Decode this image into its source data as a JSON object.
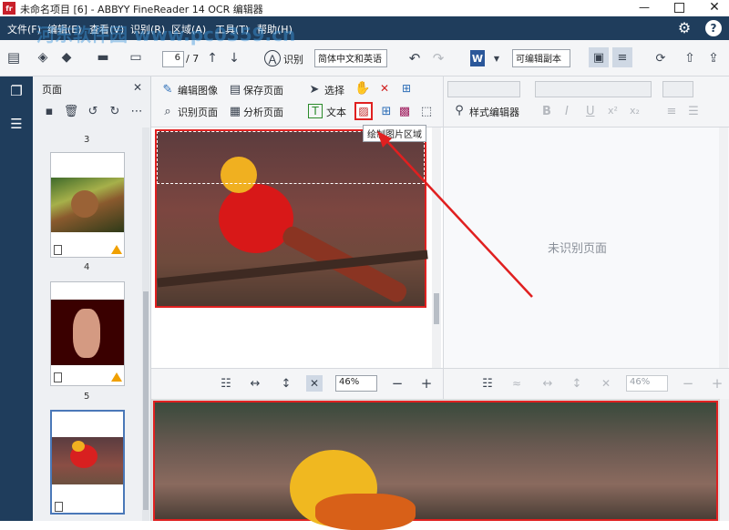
{
  "window": {
    "title": "未命名项目 [6] - ABBYY FineReader 14 OCR 编辑器",
    "app_icon": "abbyy-logo-icon",
    "controls": [
      "minimize-icon",
      "maximize-icon",
      "close-icon"
    ]
  },
  "watermark": "河东软件园 www.pc0359.cn",
  "menu": [
    {
      "label": "文件(F)"
    },
    {
      "label": "编辑(E)"
    },
    {
      "label": "查看(V)"
    },
    {
      "label": "识别(R)"
    },
    {
      "label": "区域(A)"
    },
    {
      "label": "工具(T)"
    },
    {
      "label": "帮助(H)"
    }
  ],
  "toolbar": {
    "page_current": "6",
    "page_total": "/ 7",
    "recognize_label": "识别",
    "language_value": "简体中文和英语",
    "save_format_value": "可编辑副本"
  },
  "thumbnail_panel": {
    "title": "页面",
    "pages": [
      {
        "number": "3"
      },
      {
        "number": "4"
      },
      {
        "number": "5"
      },
      {
        "number": "6"
      }
    ]
  },
  "page_tools": {
    "edit_image": "编辑图像",
    "save_page": "保存页面",
    "select": "选择",
    "recognize_page": "识别页面",
    "analyze_page": "分析页面",
    "text": "文本",
    "tooltip": "绘制图片区域"
  },
  "editor_tools": {
    "style_editor": "样式编辑器",
    "bold": "B",
    "italic": "I",
    "underline": "U",
    "superscript": "x²",
    "subscript": "x₂"
  },
  "text_pane": {
    "unrecognized": "未识别页面"
  },
  "zoom": {
    "image_zoom": "46%",
    "text_zoom": "46%"
  },
  "colors": {
    "menubar_bg": "#1f3d5c",
    "highlight_red": "#e02020",
    "selection_border": "#4a78b8"
  }
}
